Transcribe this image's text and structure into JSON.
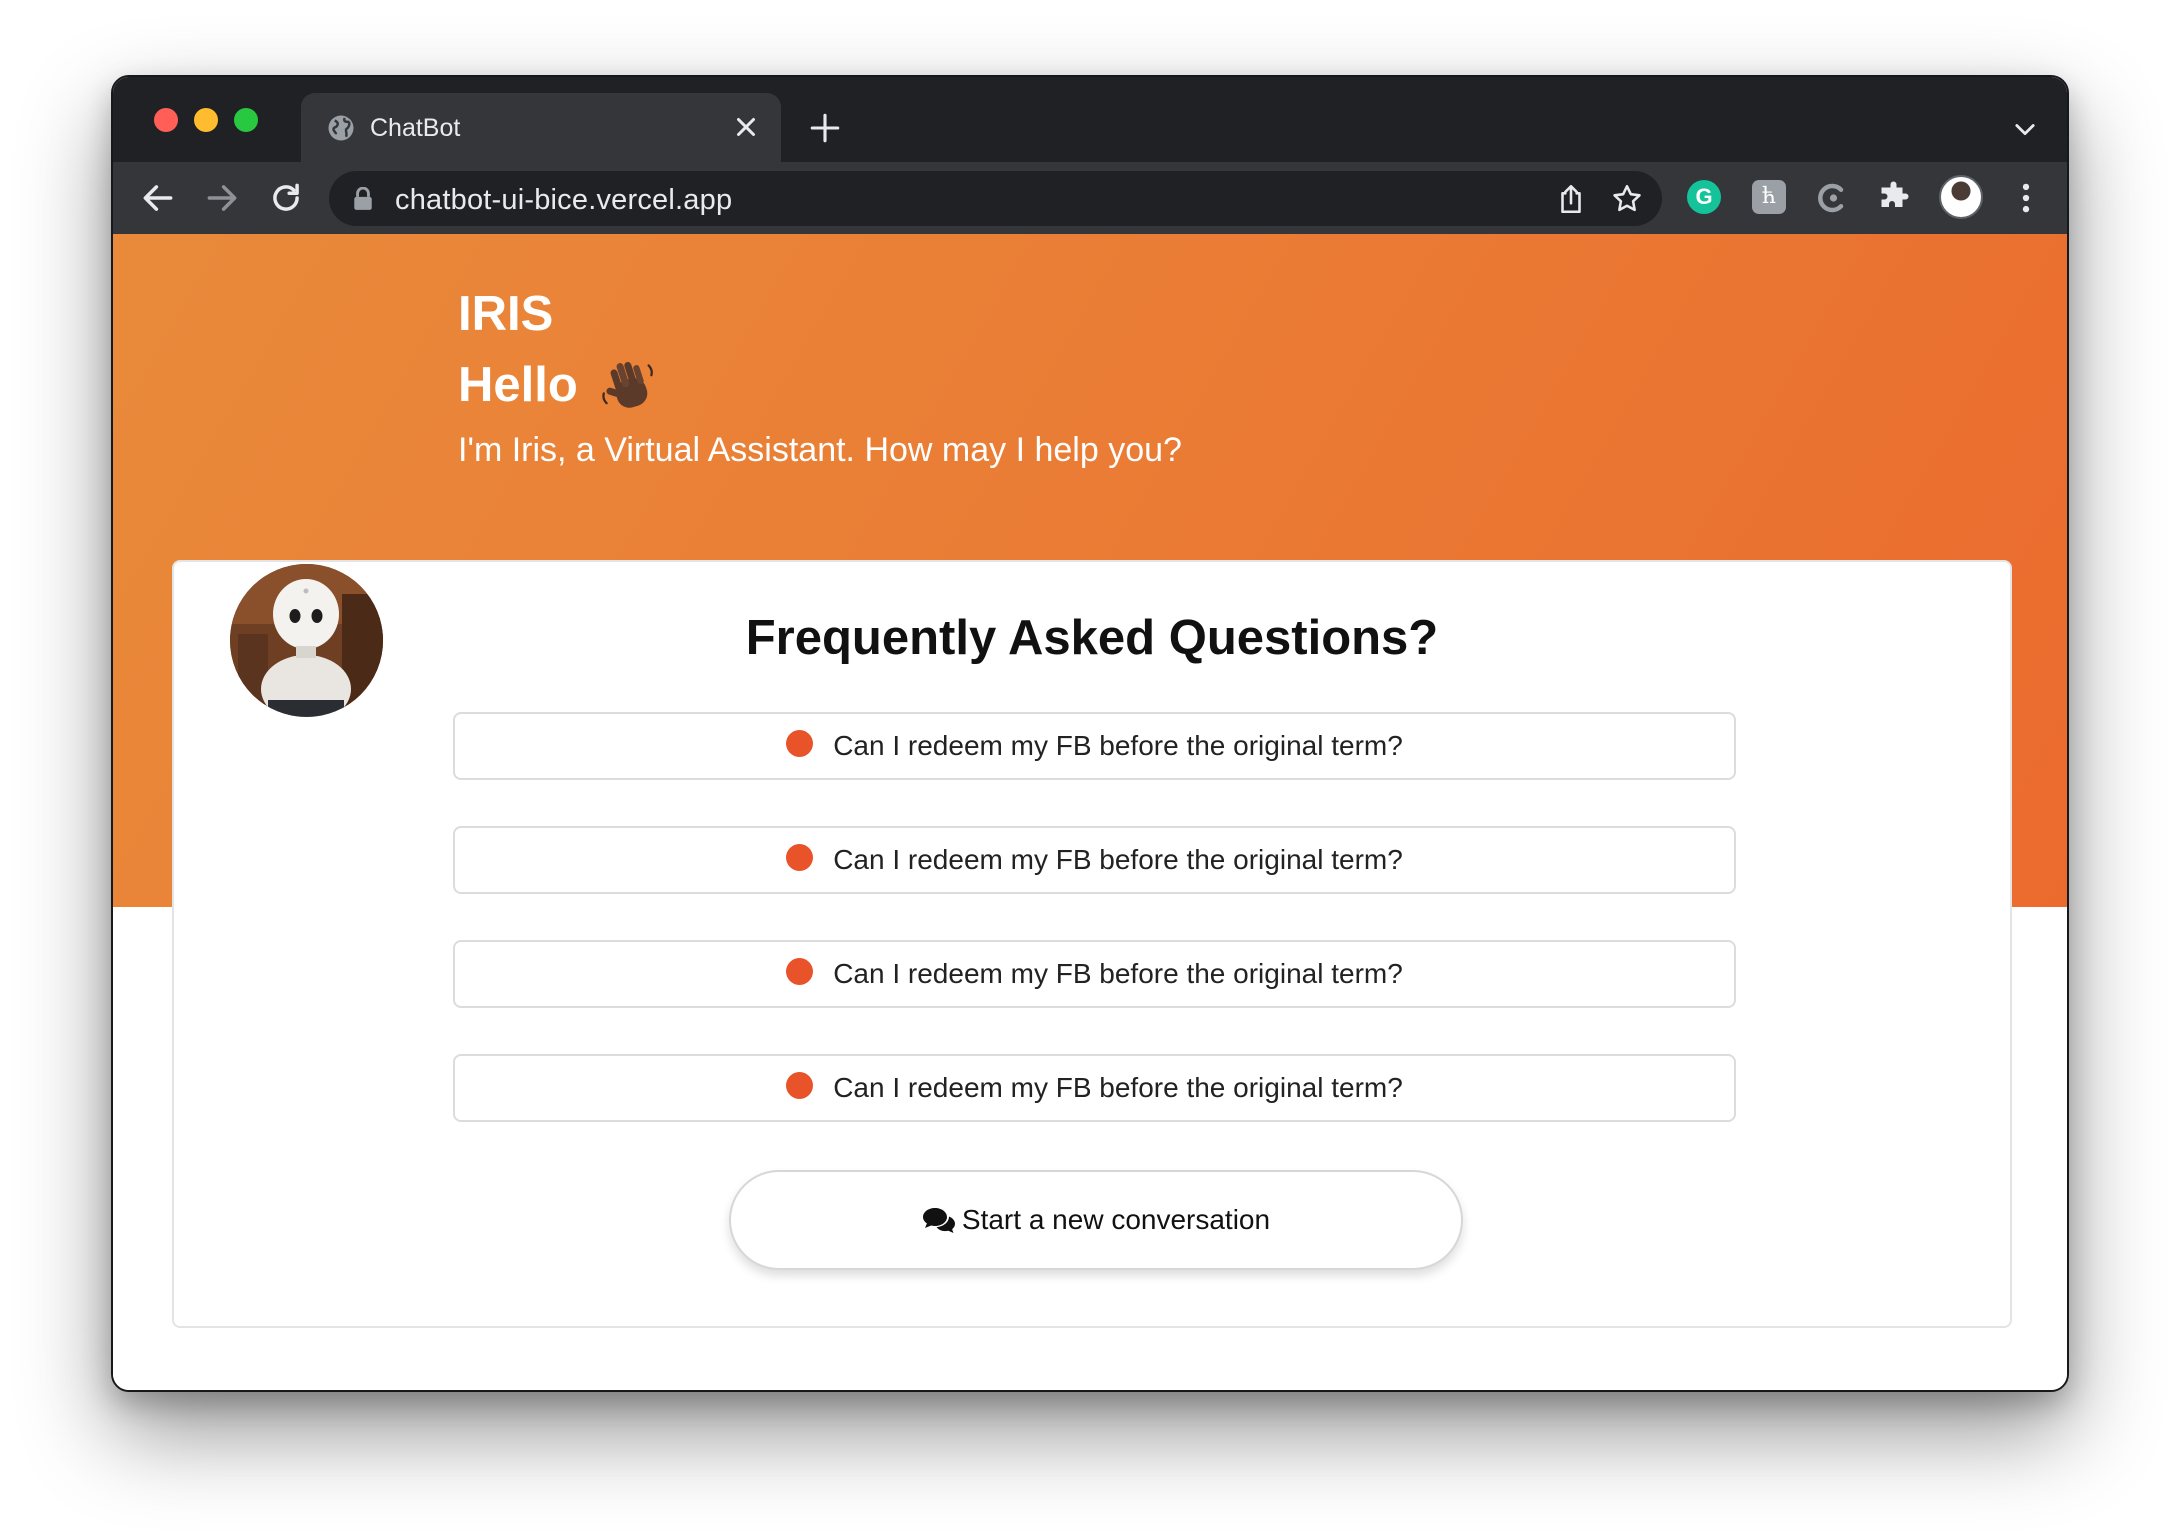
{
  "browser": {
    "tab_title": "ChatBot",
    "url": "chatbot-ui-bice.vercel.app",
    "icons": [
      "globe-icon",
      "close-icon",
      "plus-icon",
      "chevron-down-icon",
      "back-arrow-icon",
      "forward-arrow-icon",
      "reload-icon",
      "lock-icon",
      "share-icon",
      "star-icon",
      "grammarly-icon",
      "extension-h-icon",
      "extension-c-icon",
      "puzzle-icon",
      "profile-avatar",
      "more-vert-icon"
    ],
    "grammarly_letter": "G",
    "ext_h_letter": "ћ"
  },
  "hero": {
    "bot_name": "IRIS",
    "greeting": "Hello",
    "greeting_emoji": "waving-hand-icon",
    "subtitle": "I'm Iris, a Virtual Assistant. How may I help you?",
    "gradient_colors": [
      "#e98a3a",
      "#eb6b2e"
    ]
  },
  "faq": {
    "title": "Frequently Asked Questions?",
    "items": [
      {
        "text": "Can I redeem my FB before the original term?"
      },
      {
        "text": "Can I redeem my FB before the original term?"
      },
      {
        "text": "Can I redeem my FB before the original term?"
      },
      {
        "text": "Can I redeem my FB before the original term?"
      }
    ],
    "bullet_color": "#e8532a"
  },
  "actions": {
    "new_conversation_label": "Start a new conversation",
    "new_conversation_icon": "chat-bubbles-icon"
  }
}
